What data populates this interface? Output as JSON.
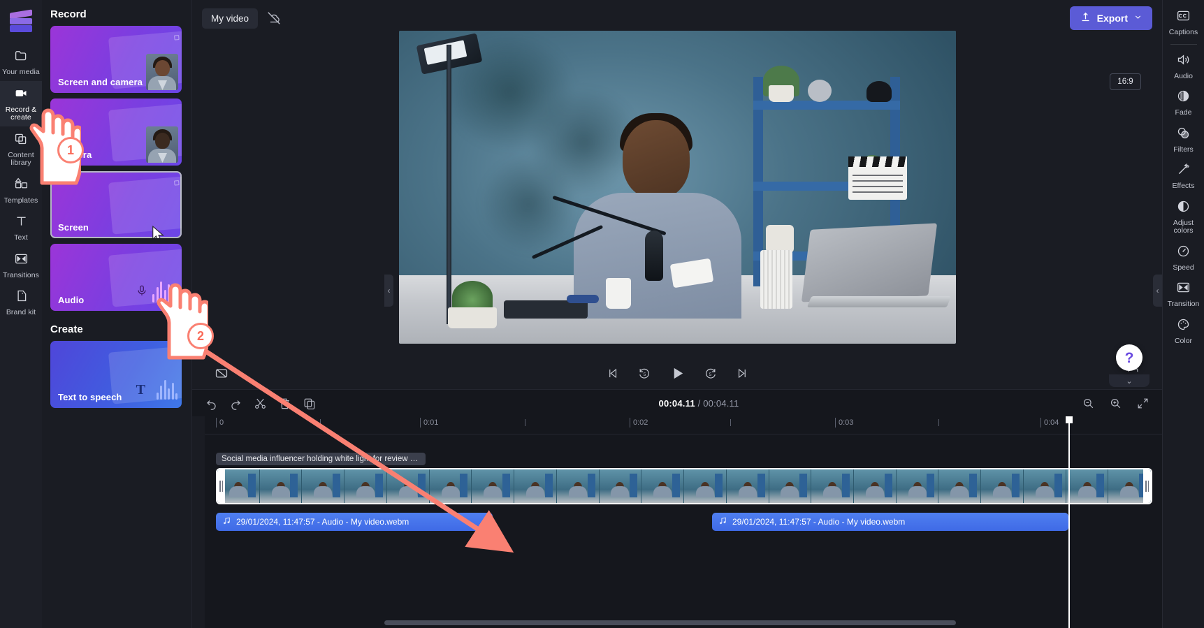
{
  "app": {
    "name": "Clipchamp Video Editor"
  },
  "left_rail": {
    "items": [
      {
        "label": "Your media",
        "icon": "folder-icon",
        "active": false
      },
      {
        "label": "Record & create",
        "icon": "video-camera-icon",
        "active": true
      },
      {
        "label": "Content library",
        "icon": "library-icon",
        "active": false
      },
      {
        "label": "Templates",
        "icon": "templates-icon",
        "active": false
      },
      {
        "label": "Text",
        "icon": "text-icon",
        "active": false
      },
      {
        "label": "Transitions",
        "icon": "transitions-icon",
        "active": false
      },
      {
        "label": "Brand kit",
        "icon": "brand-kit-icon",
        "active": false
      }
    ]
  },
  "panel": {
    "record_heading": "Record",
    "create_heading": "Create",
    "record_cards": [
      {
        "label": "Screen and camera",
        "icon": "screen-and-camera-icon"
      },
      {
        "label": "Camera",
        "icon": "camera-icon"
      },
      {
        "label": "Screen",
        "icon": "screen-icon"
      },
      {
        "label": "Audio",
        "icon": "microphone-icon"
      }
    ],
    "create_cards": [
      {
        "label": "Text to speech",
        "icon": "text-to-speech-icon"
      }
    ]
  },
  "header": {
    "project_title": "My video",
    "sync_icon": "cloud-off-icon",
    "export_label": "Export",
    "export_icon": "upload-icon",
    "export_chevron": "chevron-down-icon",
    "export_color": "#5b5bd6"
  },
  "preview": {
    "aspect_ratio": "16:9",
    "controls": [
      {
        "name": "captions-off-button",
        "icon": "captions-off-icon"
      },
      {
        "name": "skip-to-start-button",
        "icon": "skip-start-icon"
      },
      {
        "name": "rewind-5s-button",
        "icon": "rewind-5-icon"
      },
      {
        "name": "play-button",
        "icon": "play-icon"
      },
      {
        "name": "forward-5s-button",
        "icon": "forward-5-icon"
      },
      {
        "name": "skip-to-end-button",
        "icon": "skip-end-icon"
      },
      {
        "name": "fullscreen-button",
        "icon": "fullscreen-icon"
      }
    ]
  },
  "timeline": {
    "tools": [
      {
        "name": "undo-button",
        "icon": "undo-icon"
      },
      {
        "name": "redo-button",
        "icon": "redo-icon"
      },
      {
        "name": "split-button",
        "icon": "scissors-icon"
      },
      {
        "name": "delete-button",
        "icon": "trash-icon"
      },
      {
        "name": "duplicate-button",
        "icon": "duplicate-icon"
      }
    ],
    "current_time": "00:04.11",
    "total_time": "00:04.11",
    "time_separator": "/",
    "zoom_controls": [
      {
        "name": "zoom-out-button",
        "icon": "zoom-out-icon"
      },
      {
        "name": "zoom-in-button",
        "icon": "zoom-in-icon"
      },
      {
        "name": "fit-to-screen-button",
        "icon": "fit-screen-icon"
      }
    ],
    "ruler_ticks": [
      "0",
      "0:01",
      "0:02",
      "0:03",
      "0:04"
    ],
    "video_clip": {
      "title": "Social media influencer holding white light for review on...",
      "selected": true
    },
    "audio_clips": [
      {
        "label": "29/01/2024, 11:47:57 - Audio - My video.webm",
        "icon": "music-note-icon",
        "left_pct": 1.6,
        "width_pct": 32.1
      },
      {
        "label": "29/01/2024, 11:47:57 - Audio - My video.webm",
        "icon": "music-note-icon",
        "left_pct": 59.0,
        "width_pct": 41.4
      }
    ]
  },
  "right_rail": {
    "items": [
      {
        "label": "Captions",
        "icon": "captions-icon"
      },
      {
        "label": "Audio",
        "icon": "speaker-icon"
      },
      {
        "label": "Fade",
        "icon": "fade-icon"
      },
      {
        "label": "Filters",
        "icon": "filters-icon"
      },
      {
        "label": "Effects",
        "icon": "magic-wand-icon"
      },
      {
        "label": "Adjust colors",
        "icon": "contrast-icon"
      },
      {
        "label": "Speed",
        "icon": "speedometer-icon"
      },
      {
        "label": "Transition",
        "icon": "transition-icon"
      },
      {
        "label": "Color",
        "icon": "palette-icon"
      }
    ]
  },
  "help": {
    "label": "?",
    "icon": "question-mark-icon"
  },
  "annotations": {
    "accent_color": "#fa8072",
    "steps": [
      {
        "number": "1",
        "target": "record-and-create-rail-item"
      },
      {
        "number": "2",
        "target": "audio-record-card"
      }
    ]
  }
}
